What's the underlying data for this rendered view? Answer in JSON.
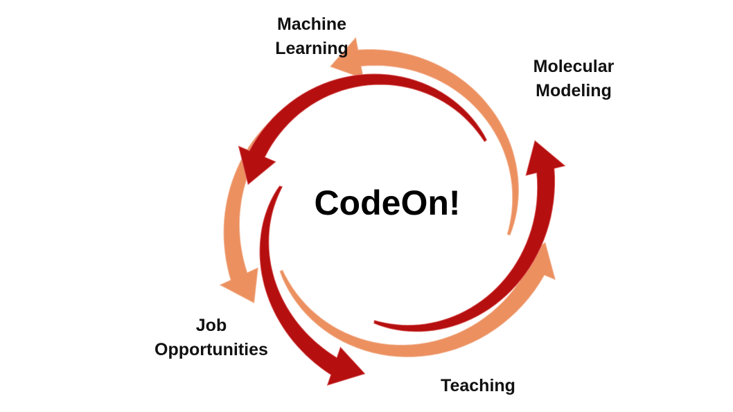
{
  "center": {
    "title": "CodeOn!"
  },
  "labels": {
    "machine_learning": [
      "Machine",
      "Learning"
    ],
    "molecular_modeling": [
      "Molecular",
      "Modeling"
    ],
    "teaching": [
      "Teaching"
    ],
    "job_opportunities": [
      "Job",
      "Opportunities"
    ]
  },
  "colors": {
    "dark_arrow": "#b50f0f",
    "light_arrow": "#ec9060",
    "text": "#111111"
  }
}
